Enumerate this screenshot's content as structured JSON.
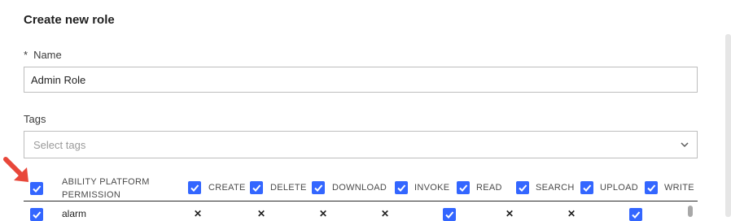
{
  "dialog": {
    "title": "Create new role"
  },
  "name_field": {
    "required_mark": "*",
    "label": "Name",
    "value": "Admin Role"
  },
  "tags_field": {
    "label": "Tags",
    "placeholder": "Select tags"
  },
  "permissions": {
    "header": {
      "label_line1": "ABILITY PLATFORM",
      "label_line2": "PERMISSION"
    },
    "columns": [
      "CREATE",
      "DELETE",
      "DOWNLOAD",
      "INVOKE",
      "READ",
      "SEARCH",
      "UPLOAD",
      "WRITE"
    ],
    "rows": [
      {
        "name": "alarm",
        "selected": true,
        "cells": [
          "✕",
          "✕",
          "✕",
          "✕",
          "checked",
          "✕",
          "✕",
          "checked"
        ]
      }
    ]
  },
  "colors": {
    "accent": "#3366ff",
    "annotation_arrow": "#e8473a"
  },
  "icons": {
    "checkbox": "check-icon",
    "dropdown": "chevron-down-icon",
    "denied": "x-mark-icon",
    "annotation": "red-arrow-icon"
  }
}
